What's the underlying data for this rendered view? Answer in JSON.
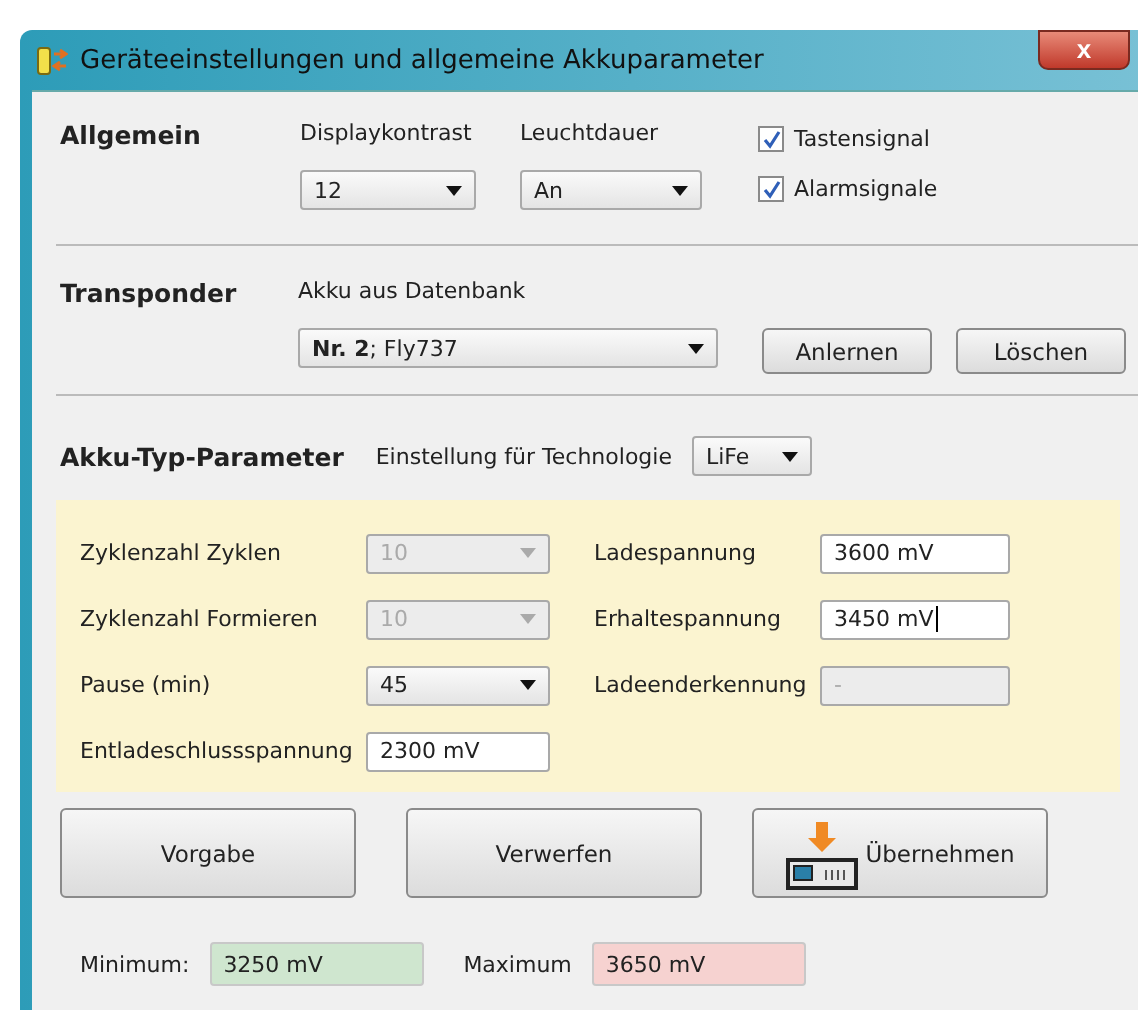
{
  "window": {
    "title": "Geräteeinstellungen und allgemeine Akkuparameter",
    "close": "x"
  },
  "general": {
    "heading": "Allgemein",
    "contrast": {
      "label": "Displaykontrast",
      "value": "12"
    },
    "light": {
      "label": "Leuchtdauer",
      "value": "An"
    },
    "checkboxes": [
      {
        "label": "Tastensignal",
        "checked": true
      },
      {
        "label": "Alarmsignale",
        "checked": true
      }
    ]
  },
  "transponder": {
    "heading": "Transponder",
    "label": "Akku aus Datenbank",
    "value": "**Nr. 2**; Fly737",
    "buttons": [
      "Anlernen",
      "Löschen"
    ]
  },
  "battery": {
    "heading": "Akku-Typ-Parameter",
    "tech_label": "Einstellung für Technologie",
    "tech_value": "LiFe",
    "left": [
      {
        "label": "Zyklenzahl Zyklen",
        "kind": "combo",
        "value": "10",
        "disabled": true
      },
      {
        "label": "Zyklenzahl Formieren",
        "kind": "combo",
        "value": "10",
        "disabled": true
      },
      {
        "label": "Pause (min)",
        "kind": "combo",
        "value": "45",
        "disabled": false
      },
      {
        "label": "Entladeschlussspannung",
        "kind": "input",
        "value": "2300 mV",
        "disabled": false
      }
    ],
    "right": [
      {
        "label": "Ladespannung",
        "kind": "input",
        "value": "3600 mV",
        "disabled": false,
        "focused": false
      },
      {
        "label": "Erhaltespannung",
        "kind": "input",
        "value": "3450 mV",
        "disabled": false,
        "focused": true
      },
      {
        "label": "Ladeenderkennung",
        "kind": "input",
        "value": "-",
        "disabled": true,
        "focused": false
      }
    ]
  },
  "buttons": [
    {
      "label": "Vorgabe",
      "kind": "plain"
    },
    {
      "label": "Verwerfen",
      "kind": "plain"
    },
    {
      "label": "Übernehmen",
      "kind": "device"
    }
  ],
  "limits": [
    {
      "label": "Minimum:",
      "value": "3250 mV",
      "color": "#cfe6cf"
    },
    {
      "label": "Maximum",
      "value": "3650 mV",
      "color": "#f6d2d0"
    }
  ]
}
